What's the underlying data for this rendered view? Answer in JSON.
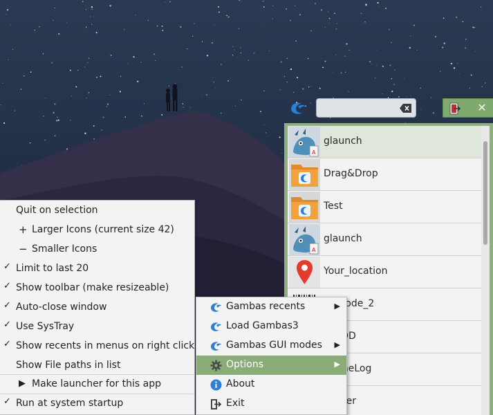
{
  "search": {
    "value": "",
    "placeholder": ""
  },
  "launcher": {
    "items": [
      {
        "label": "glaunch",
        "icon": "glaunch-icon"
      },
      {
        "label": "Drag&Drop",
        "icon": "gambas-folder-icon"
      },
      {
        "label": "Test",
        "icon": "gambas-folder-icon"
      },
      {
        "label": "glaunch",
        "icon": "glaunch-icon"
      },
      {
        "label": "Your_location",
        "icon": "location-pin-icon"
      },
      {
        "label": "Barcode_2",
        "icon": "barcode-icon"
      },
      {
        "label": "_APOD",
        "icon": "app-icon"
      },
      {
        "label": "asOneLog",
        "icon": "app-icon"
      },
      {
        "label": "_Timer",
        "icon": "app-icon"
      }
    ]
  },
  "main_menu": {
    "items": [
      {
        "label": "Quit on selection",
        "checked": false
      },
      {
        "label": "Larger Icons (current size 42)",
        "symbol": "+"
      },
      {
        "label": "Smaller Icons",
        "symbol": "−"
      },
      {
        "label": "Limit to last 20",
        "checked": true
      },
      {
        "label": "Show toolbar (make resizeable)",
        "checked": true
      },
      {
        "label": "Auto-close window",
        "checked": true
      },
      {
        "label": "Use SysTray",
        "checked": true
      },
      {
        "label": "Show recents in menus on right click",
        "checked": true
      },
      {
        "label": "Show File paths in list",
        "checked": false
      },
      {
        "label": "Make launcher for this app",
        "symbol": "▶"
      },
      {
        "label": "Run at system startup",
        "checked": true
      }
    ]
  },
  "sub_menu": {
    "items": [
      {
        "label": "Gambas recents",
        "icon": "gambas-icon",
        "submenu": true
      },
      {
        "label": "Load Gambas3",
        "icon": "gambas-icon",
        "submenu": false
      },
      {
        "label": "Gambas GUI modes",
        "icon": "gambas-icon",
        "submenu": true
      },
      {
        "label": "Options",
        "icon": "gear-icon",
        "submenu": true,
        "highlighted": true
      },
      {
        "label": "About",
        "icon": "info-icon",
        "submenu": false
      },
      {
        "label": "Exit",
        "icon": "exit-icon",
        "submenu": false
      }
    ]
  },
  "colors": {
    "accent": "#8aac79",
    "menu_bg": "#f3f3f3",
    "list_border": "#8fb07e"
  }
}
